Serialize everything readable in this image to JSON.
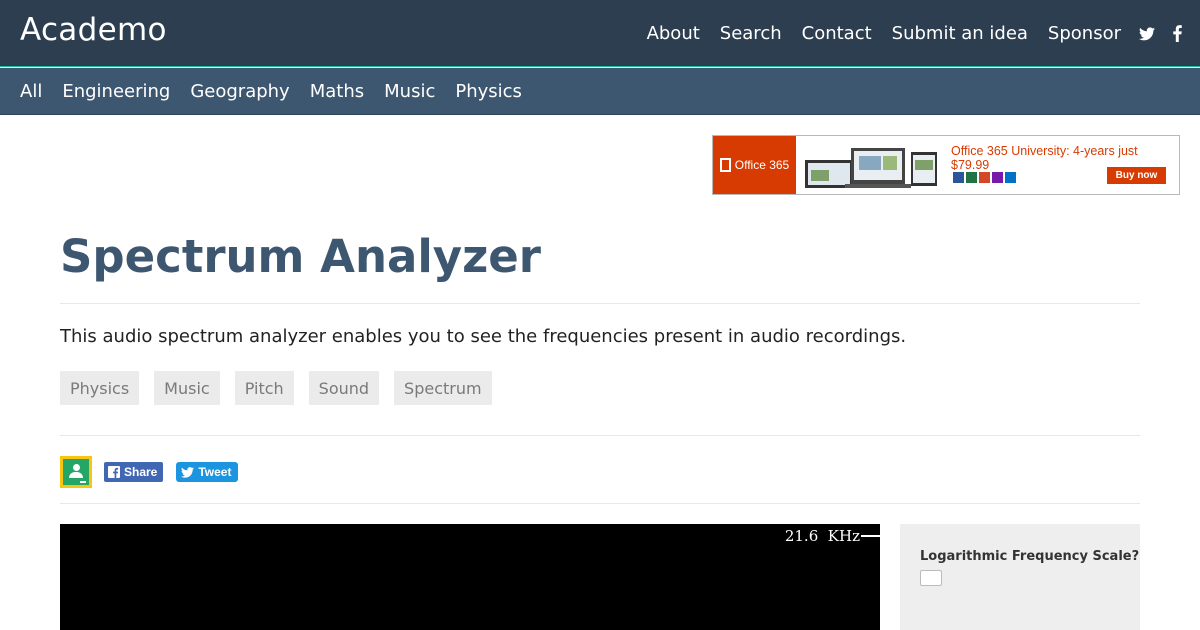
{
  "header": {
    "brand": "Academo",
    "nav": [
      "About",
      "Search",
      "Contact",
      "Submit an idea",
      "Sponsor"
    ],
    "social_icons": [
      "twitter-icon",
      "facebook-icon"
    ]
  },
  "categories": [
    "All",
    "Engineering",
    "Geography",
    "Maths",
    "Music",
    "Physics"
  ],
  "ad": {
    "brand_label": "Office 365",
    "headline": "Office 365 University: 4-years just $79.99",
    "button": "Buy now"
  },
  "page": {
    "title": "Spectrum Analyzer",
    "description": "This audio spectrum analyzer enables you to see the frequencies present in audio recordings.",
    "tags": [
      "Physics",
      "Music",
      "Pitch",
      "Sound",
      "Spectrum"
    ]
  },
  "share": {
    "facebook": "Share",
    "twitter": "Tweet"
  },
  "analyzer": {
    "frequency_value": "21.6",
    "frequency_unit": "KHz"
  },
  "controls": {
    "log_scale_label": "Logarithmic Frequency Scale?",
    "log_scale_checked": false
  },
  "colors": {
    "navbar": "#2c3e50",
    "category_bar": "#3e5770",
    "title": "#3e5770",
    "ad_accent": "#d83b01"
  }
}
